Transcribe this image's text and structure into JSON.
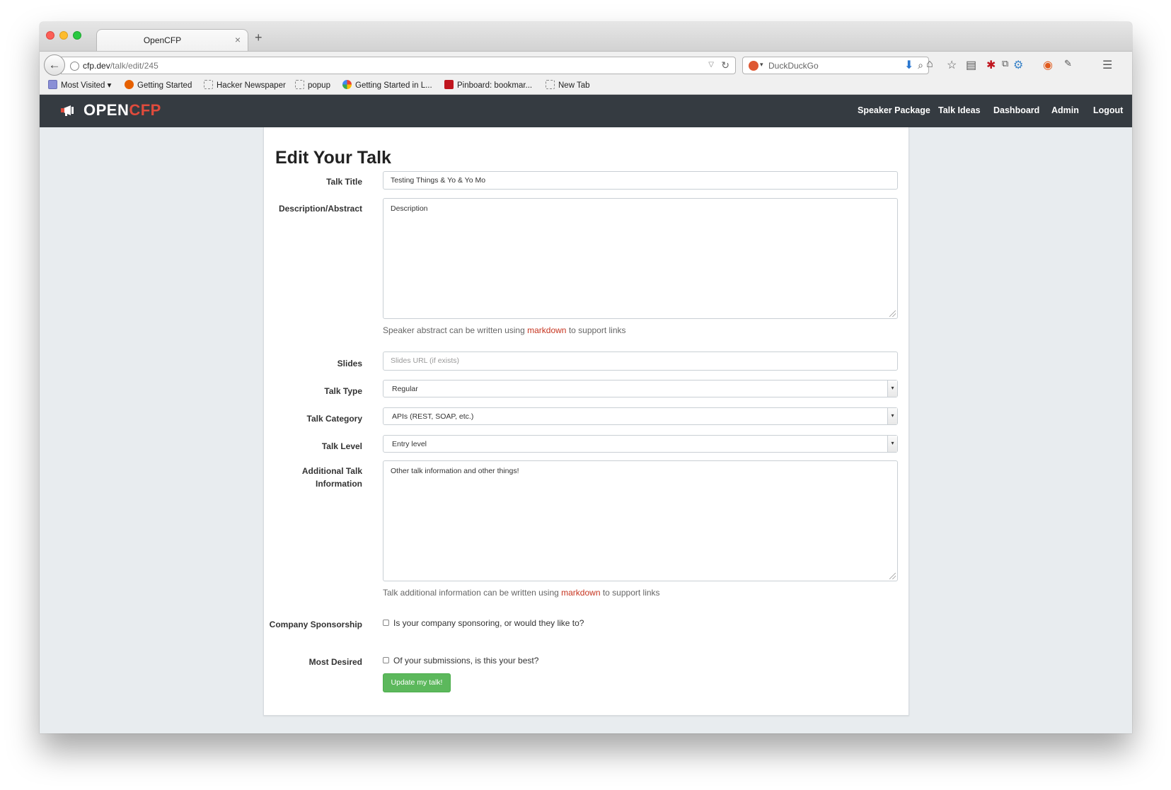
{
  "browser": {
    "tab_title": "OpenCFP",
    "tab_close": "×",
    "new_tab": "+",
    "url_path": "/talk/edit/245",
    "url_host": "cfp.dev",
    "search_placeholder": "DuckDuckGo",
    "bookmarks": [
      {
        "label": "Most Visited",
        "icon": "folder-icon"
      },
      {
        "label": "Getting Started",
        "icon": "firefox-icon"
      },
      {
        "label": "Hacker Newspaper",
        "icon": "page-icon"
      },
      {
        "label": "popup",
        "icon": "page-icon"
      },
      {
        "label": "Getting Started in L...",
        "icon": "google-icon"
      },
      {
        "label": "Pinboard: bookmar...",
        "icon": "pinboard-icon"
      },
      {
        "label": "New Tab",
        "icon": "page-icon"
      }
    ]
  },
  "site": {
    "logo_open": "OPEN",
    "logo_cfp": "CFP",
    "nav": [
      "Speaker Package",
      "Talk Ideas",
      "Dashboard",
      "Admin",
      "Logout"
    ]
  },
  "form": {
    "title": "Edit Your Talk",
    "talk_title_label": "Talk Title",
    "talk_title_value": "Testing Things & Yo & Yo Mo",
    "description_label": "Description/Abstract",
    "description_value": "Description",
    "description_help_prefix": "Speaker abstract can be written using ",
    "description_help_link": "markdown",
    "description_help_suffix": " to support links",
    "slides_label": "Slides",
    "slides_placeholder": "Slides URL (if exists)",
    "talk_type_label": "Talk Type",
    "talk_type_value": "Regular",
    "talk_category_label": "Talk Category",
    "talk_category_value": "APIs (REST, SOAP, etc.)",
    "talk_level_label": "Talk Level",
    "talk_level_value": "Entry level",
    "additional_label": "Additional Talk Information",
    "additional_value": "Other talk information and other things!",
    "additional_help_prefix": "Talk additional information can be written using ",
    "additional_help_link": "markdown",
    "additional_help_suffix": " to support links",
    "sponsorship_label": "Company Sponsorship",
    "sponsorship_text": "Is your company sponsoring, or would they like to?",
    "sponsorship_checked": false,
    "desired_label": "Most Desired",
    "desired_text": "Of your submissions, is this your best?",
    "desired_checked": false,
    "submit_label": "Update my talk!"
  },
  "colors": {
    "header_bg": "#353b41",
    "brand_red": "#e04b3c",
    "button_green": "#5cb85c",
    "link_red": "#c6341f",
    "page_bg": "#e8ecef"
  }
}
